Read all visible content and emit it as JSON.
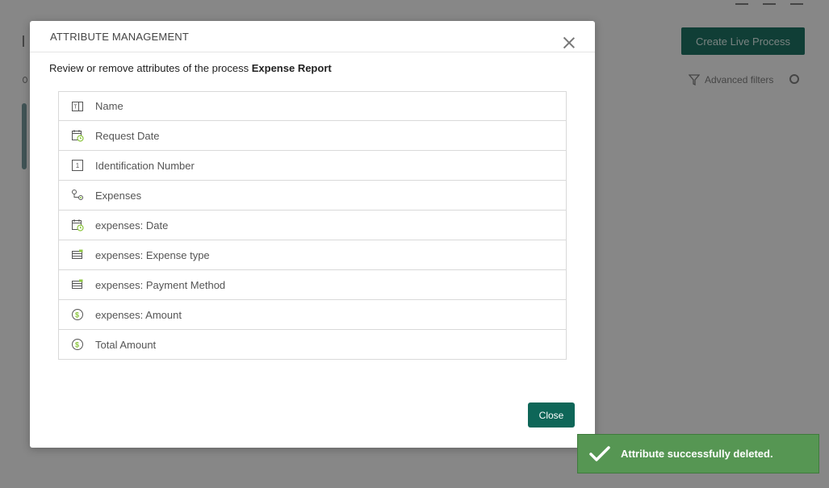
{
  "background": {
    "create_button_label": "Create Live Process",
    "advanced_filters_label": "Advanced filters"
  },
  "modal": {
    "title": "ATTRIBUTE MANAGEMENT",
    "intro_prefix": "Review or remove attributes of the process ",
    "process_name": "Expense Report",
    "attributes": [
      {
        "label": "Name",
        "icon": "text-field-icon"
      },
      {
        "label": "Request Date",
        "icon": "calendar-icon"
      },
      {
        "label": "Identification Number",
        "icon": "number-icon"
      },
      {
        "label": "Expenses",
        "icon": "subprocess-icon"
      },
      {
        "label": "expenses: Date",
        "icon": "calendar-icon"
      },
      {
        "label": "expenses: Expense type",
        "icon": "list-icon"
      },
      {
        "label": "expenses: Payment Method",
        "icon": "list-icon"
      },
      {
        "label": "expenses: Amount",
        "icon": "currency-icon"
      },
      {
        "label": "Total Amount",
        "icon": "currency-icon"
      }
    ],
    "close_button_label": "Close"
  },
  "toast": {
    "message": "Attribute successfully deleted."
  },
  "colors": {
    "accent": "#0e6658",
    "icon_green": "#8dc63f",
    "toast_bg": "#569653"
  }
}
